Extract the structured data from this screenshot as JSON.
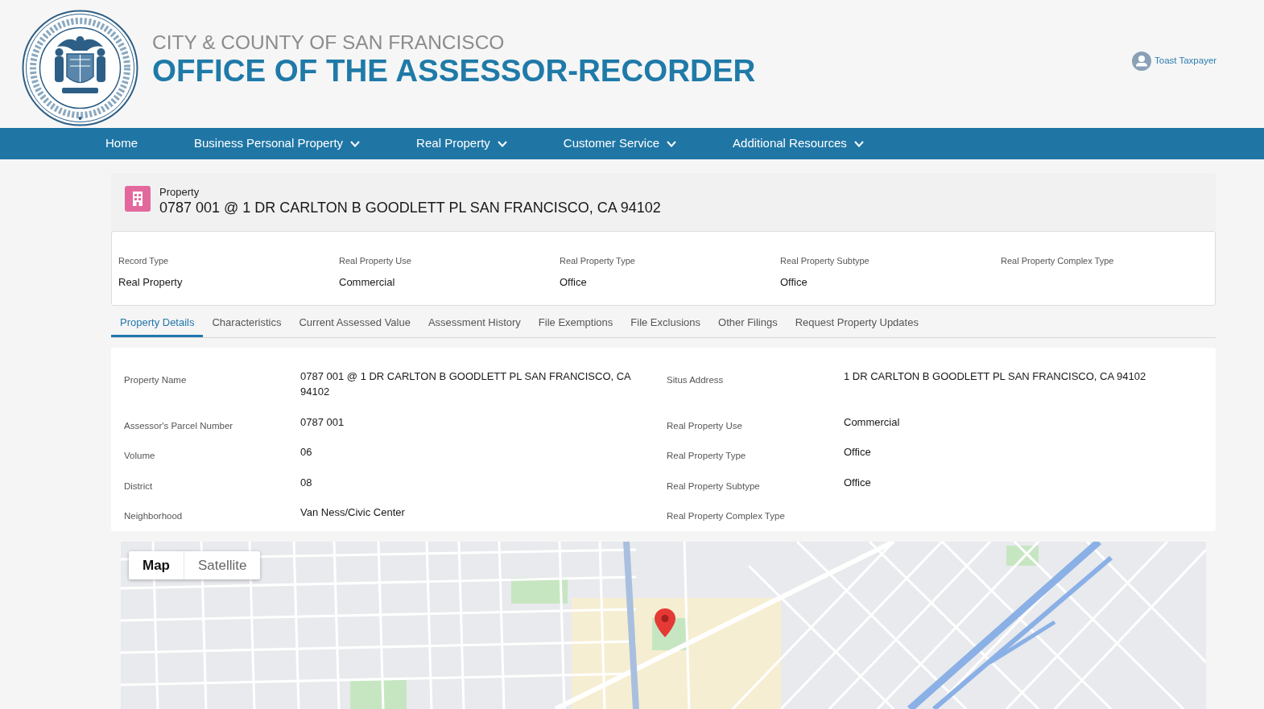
{
  "header": {
    "subtitle": "CITY & COUNTY OF SAN FRANCISCO",
    "title": "OFFICE OF THE ASSESSOR-RECORDER",
    "user": "Toast Taxpayer"
  },
  "nav": [
    {
      "label": "Home",
      "dropdown": false
    },
    {
      "label": "Business Personal Property",
      "dropdown": true
    },
    {
      "label": "Real Property",
      "dropdown": true
    },
    {
      "label": "Customer Service",
      "dropdown": true
    },
    {
      "label": "Additional Resources",
      "dropdown": true
    }
  ],
  "record": {
    "object_type": "Property",
    "title": "0787 001 @ 1 DR CARLTON B GOODLETT PL SAN FRANCISCO, CA 94102"
  },
  "highlights": [
    {
      "label": "Record Type",
      "value": "Real Property"
    },
    {
      "label": "Real Property Use",
      "value": "Commercial"
    },
    {
      "label": "Real Property Type",
      "value": "Office"
    },
    {
      "label": "Real Property Subtype",
      "value": "Office"
    },
    {
      "label": "Real Property Complex Type"
    }
  ],
  "tabs": [
    {
      "label": "Property Details",
      "selected": true
    },
    {
      "label": "Characteristics",
      "selected": false
    },
    {
      "label": "Current Assessed Value",
      "selected": false
    },
    {
      "label": "Assessment History",
      "selected": false
    },
    {
      "label": "File Exemptions",
      "selected": false
    },
    {
      "label": "File Exclusions",
      "selected": false
    },
    {
      "label": "Other Filings",
      "selected": false
    },
    {
      "label": "Request Property Updates",
      "selected": false
    }
  ],
  "details": {
    "left": [
      {
        "label": "Property Name",
        "value": "0787 001 @ 1 DR CARLTON B GOODLETT PL SAN FRANCISCO, CA 94102"
      },
      {
        "label": "Assessor's Parcel Number",
        "value": "0787 001"
      },
      {
        "label": "Volume",
        "value": "06"
      },
      {
        "label": "District",
        "value": "08"
      },
      {
        "label": "Neighborhood",
        "value": "Van Ness/Civic Center"
      }
    ],
    "right": [
      {
        "label": "Situs Address",
        "value": "1 DR CARLTON B GOODLETT PL SAN FRANCISCO, CA 94102"
      },
      {
        "label": "Real Property Use",
        "value": "Commercial"
      },
      {
        "label": "Real Property Type",
        "value": "Office"
      },
      {
        "label": "Real Property Subtype",
        "value": "Office"
      },
      {
        "label": "Real Property Complex Type"
      }
    ]
  },
  "map": {
    "view_types": [
      {
        "label": "Map",
        "selected": true
      },
      {
        "label": "Satellite",
        "selected": false
      }
    ]
  }
}
